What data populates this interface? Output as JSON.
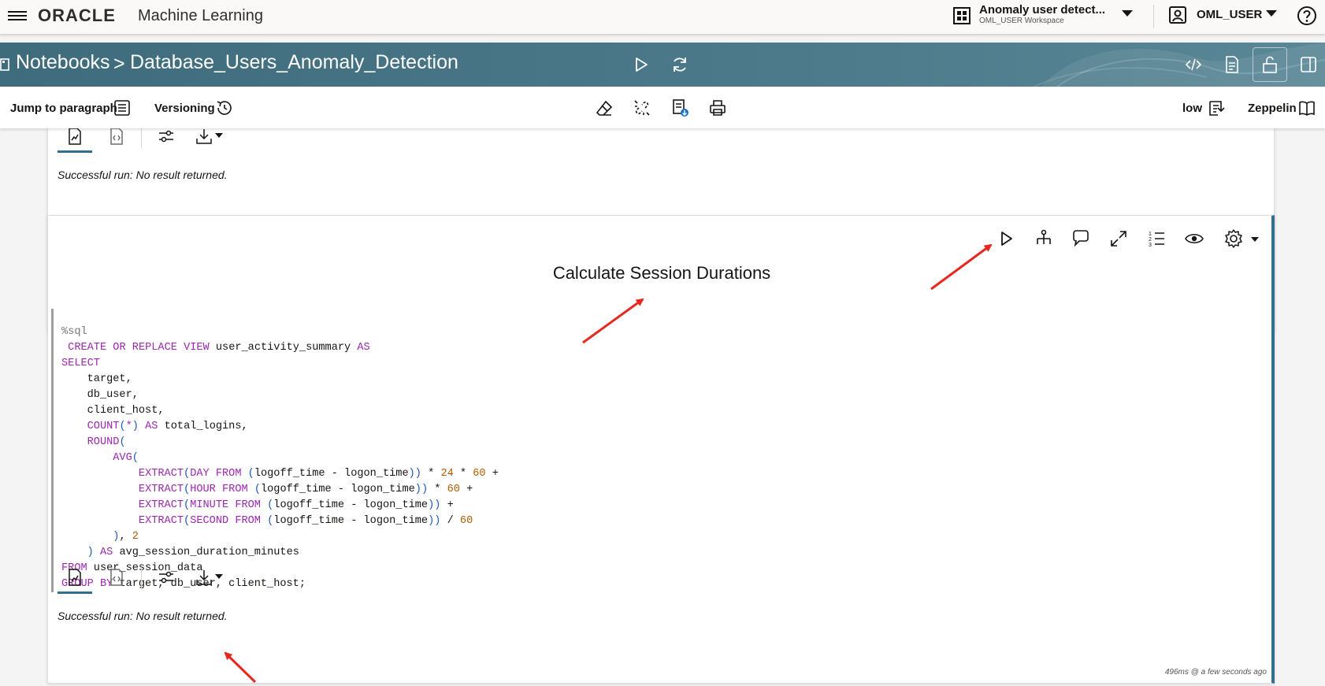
{
  "header": {
    "brand": "ORACLE",
    "product": "Machine Learning",
    "workspace_name": "Anomaly user detect...",
    "workspace_sub": "OML_USER Workspace",
    "user_name": "OML_USER"
  },
  "banner": {
    "breadcrumb_root": "Notebooks",
    "breadcrumb_sep": ">",
    "notebook_title": "Database_Users_Anomaly_Detection"
  },
  "toolbar": {
    "jump_label": "Jump to paragraph",
    "versioning_label": "Versioning",
    "connection_label": "low",
    "interpreter_label": "Zeppelin"
  },
  "prev_paragraph": {
    "status": "Successful run: No result returned."
  },
  "paragraph": {
    "title": "Calculate Session Durations",
    "status": "Successful run: No result returned.",
    "timing": "496ms @ a few seconds ago",
    "code_lines": [
      "%sql",
      " CREATE OR REPLACE VIEW user_activity_summary AS",
      "SELECT",
      "    target,",
      "    db_user,",
      "    client_host,",
      "    COUNT(*) AS total_logins,",
      "    ROUND(",
      "        AVG(",
      "            EXTRACT(DAY FROM (logoff_time - logon_time)) * 24 * 60 +",
      "            EXTRACT(HOUR FROM (logoff_time - logon_time)) * 60 +",
      "            EXTRACT(MINUTE FROM (logoff_time - logon_time)) +",
      "            EXTRACT(SECOND FROM (logoff_time - logon_time)) / 60",
      "        ), 2",
      "    ) AS avg_session_duration_minutes",
      "FROM user_session_data",
      "GROUP BY target, db_user, client_host;"
    ]
  },
  "colors": {
    "banner": "#4c7a8a",
    "accent": "#2f6f8f",
    "keyword": "#9c27b0",
    "number": "#b55a00",
    "annotation": "#e8281e"
  }
}
